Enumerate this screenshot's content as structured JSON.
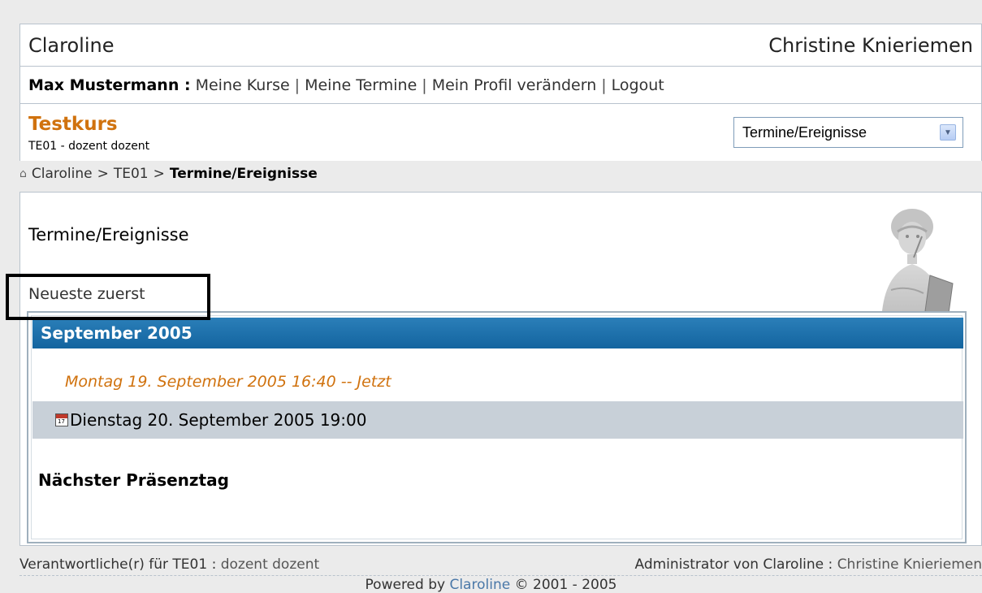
{
  "header": {
    "site_name": "Claroline",
    "institution_name": "Christine Knieriemen"
  },
  "user_bar": {
    "user_name": "Max Mustermann :",
    "links": [
      "Meine Kurse",
      "Meine Termine",
      "Mein Profil verändern",
      "Logout"
    ],
    "separator": "|"
  },
  "course": {
    "title": "Testkurs",
    "subtitle": "TE01 - dozent dozent",
    "tool_select_value": "Termine/Ereignisse"
  },
  "breadcrumb": {
    "items": [
      "Claroline",
      "TE01"
    ],
    "current": "Termine/Ereignisse",
    "separator": ">"
  },
  "main": {
    "page_title": "Termine/Ereignisse",
    "order_link": "Neueste zuerst",
    "month_header": "September 2005",
    "now_line": "Montag 19. September 2005 16:40 -- Jetzt",
    "event_date": "Dienstag 20. September 2005 19:00",
    "section_heading": "Nächster Präsenztag"
  },
  "footer": {
    "manager_label": "Verantwortliche(r) für TE01 :",
    "manager_name": "dozent dozent",
    "admin_label": "Administrator von Claroline :",
    "admin_name": "Christine Knieriemen",
    "powered_prefix": "Powered by",
    "powered_link": "Claroline",
    "powered_suffix": "© 2001 - 2005"
  },
  "colors": {
    "accent_orange": "#d0720e",
    "header_blue": "#13649f",
    "event_row_gray": "#c8d0d8"
  }
}
